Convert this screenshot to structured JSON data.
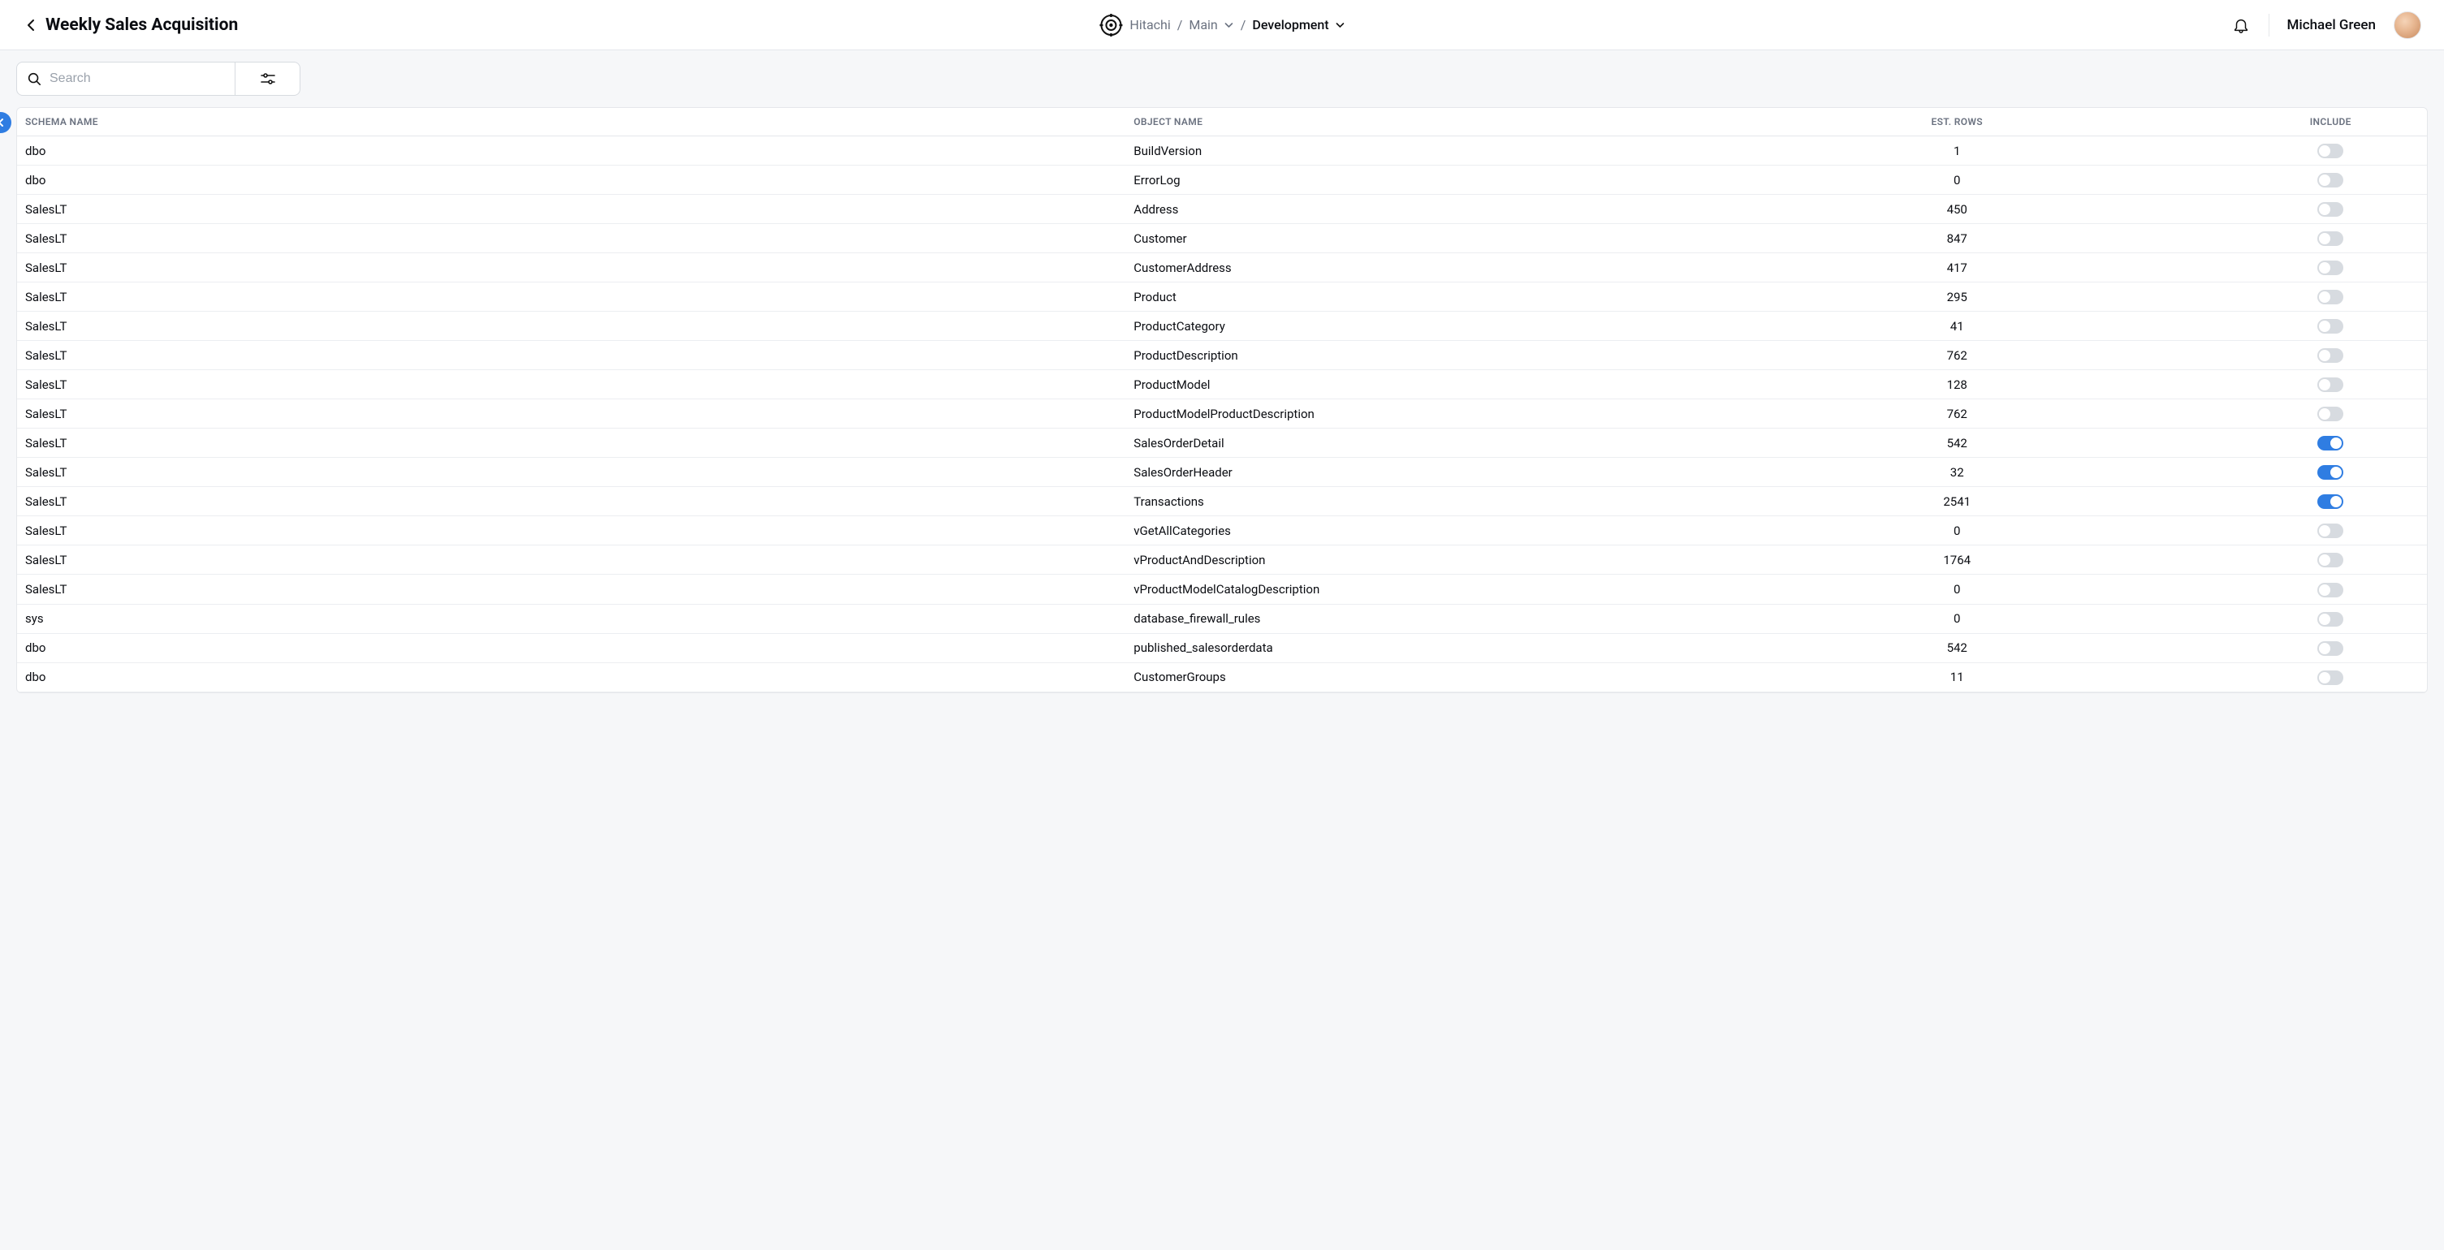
{
  "header": {
    "title": "Weekly Sales Acquisition",
    "breadcrumb": {
      "org": "Hitachi",
      "project": "Main",
      "env": "Development",
      "sep": "/"
    },
    "user_name": "Michael Green"
  },
  "toolbar": {
    "search_placeholder": "Search"
  },
  "table": {
    "columns": {
      "schema": "Schema Name",
      "object": "Object Name",
      "rows": "Est. Rows",
      "include": "Include"
    },
    "rows": [
      {
        "schema": "dbo",
        "object": "BuildVersion",
        "est_rows": "1",
        "include": false
      },
      {
        "schema": "dbo",
        "object": "ErrorLog",
        "est_rows": "0",
        "include": false
      },
      {
        "schema": "SalesLT",
        "object": "Address",
        "est_rows": "450",
        "include": false
      },
      {
        "schema": "SalesLT",
        "object": "Customer",
        "est_rows": "847",
        "include": false
      },
      {
        "schema": "SalesLT",
        "object": "CustomerAddress",
        "est_rows": "417",
        "include": false
      },
      {
        "schema": "SalesLT",
        "object": "Product",
        "est_rows": "295",
        "include": false
      },
      {
        "schema": "SalesLT",
        "object": "ProductCategory",
        "est_rows": "41",
        "include": false
      },
      {
        "schema": "SalesLT",
        "object": "ProductDescription",
        "est_rows": "762",
        "include": false
      },
      {
        "schema": "SalesLT",
        "object": "ProductModel",
        "est_rows": "128",
        "include": false
      },
      {
        "schema": "SalesLT",
        "object": "ProductModelProductDescription",
        "est_rows": "762",
        "include": false
      },
      {
        "schema": "SalesLT",
        "object": "SalesOrderDetail",
        "est_rows": "542",
        "include": true
      },
      {
        "schema": "SalesLT",
        "object": "SalesOrderHeader",
        "est_rows": "32",
        "include": true
      },
      {
        "schema": "SalesLT",
        "object": "Transactions",
        "est_rows": "2541",
        "include": true
      },
      {
        "schema": "SalesLT",
        "object": "vGetAllCategories",
        "est_rows": "0",
        "include": false
      },
      {
        "schema": "SalesLT",
        "object": "vProductAndDescription",
        "est_rows": "1764",
        "include": false
      },
      {
        "schema": "SalesLT",
        "object": "vProductModelCatalogDescription",
        "est_rows": "0",
        "include": false
      },
      {
        "schema": "sys",
        "object": "database_firewall_rules",
        "est_rows": "0",
        "include": false
      },
      {
        "schema": "dbo",
        "object": "published_salesorderdata",
        "est_rows": "542",
        "include": false
      },
      {
        "schema": "dbo",
        "object": "CustomerGroups",
        "est_rows": "11",
        "include": false
      }
    ]
  }
}
